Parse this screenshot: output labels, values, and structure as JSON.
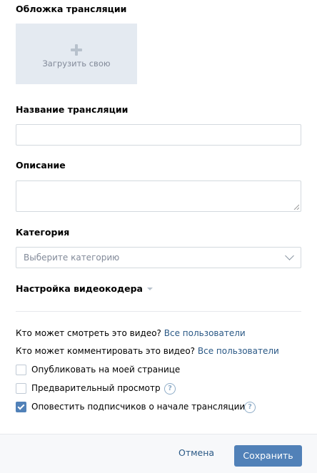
{
  "cover": {
    "title": "Обложка трансляции",
    "upload_label": "Загрузить свою",
    "icon": "plus-icon"
  },
  "stream_name": {
    "label": "Название трансляции",
    "value": ""
  },
  "description": {
    "label": "Описание",
    "value": ""
  },
  "category": {
    "label": "Категория",
    "placeholder": "Выберите категорию"
  },
  "encoder": {
    "label": "Настройка видеокодера"
  },
  "privacy": {
    "view_question": "Кто может смотреть это видео?",
    "view_value": "Все пользователи",
    "comment_question": "Кто может комментировать это видео?",
    "comment_value": "Все пользователи"
  },
  "options": [
    {
      "label": "Опубликовать на моей странице",
      "checked": false,
      "help": false
    },
    {
      "label": "Предварительный просмотр",
      "checked": false,
      "help": true
    },
    {
      "label": "Оповестить подписчиков о начале трансляции",
      "checked": true,
      "help": true
    }
  ],
  "help_glyph": "?",
  "footer": {
    "cancel_label": "Отмена",
    "save_label": "Сохранить"
  },
  "colors": {
    "accent": "#5181b8",
    "link": "#2a5885",
    "cover_bg": "#e4eaf1"
  }
}
